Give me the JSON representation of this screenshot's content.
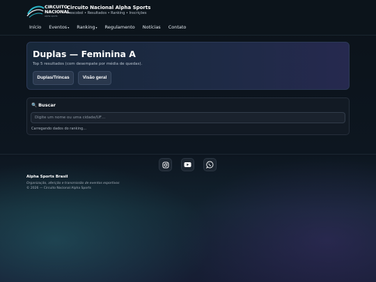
{
  "header": {
    "logo_line1": "CIRCUITO",
    "logo_line2": "NACIONAL",
    "logo_sub": "alpha sports",
    "title": "Circuito Nacional Alpha Sports",
    "subtitle": "Frescobol • Resultados • Ranking • Inscrições",
    "brand_color": "#2bb7c9"
  },
  "nav": {
    "items": [
      {
        "label": "Início"
      },
      {
        "label": "Eventos",
        "has_dropdown": true
      },
      {
        "label": "Ranking",
        "has_dropdown": true
      },
      {
        "label": "Regulamento"
      },
      {
        "label": "Notícias"
      },
      {
        "label": "Contato"
      }
    ]
  },
  "hero": {
    "title": "Duplas — Feminina A",
    "subtitle": "Top 5 resultados (com desempate por média de quedas).",
    "buttons": [
      {
        "label": "Duplas/Trincas"
      },
      {
        "label": "Visão geral"
      }
    ]
  },
  "search": {
    "icon": "search-icon",
    "title": "Buscar",
    "placeholder": "Digite um nome ou uma cidade/UF…",
    "value": "",
    "status": "Carregando dados do ranking..."
  },
  "social": {
    "items": [
      {
        "icon": "instagram-icon"
      },
      {
        "icon": "youtube-icon"
      },
      {
        "icon": "whatsapp-icon"
      }
    ]
  },
  "footer": {
    "brand": "Alpha Sports Brasil",
    "tagline": "Organização, aferição e transmissão de eventos esportivos",
    "copyright": "© 2026 — Circuito Nacional Alpha Sports"
  }
}
